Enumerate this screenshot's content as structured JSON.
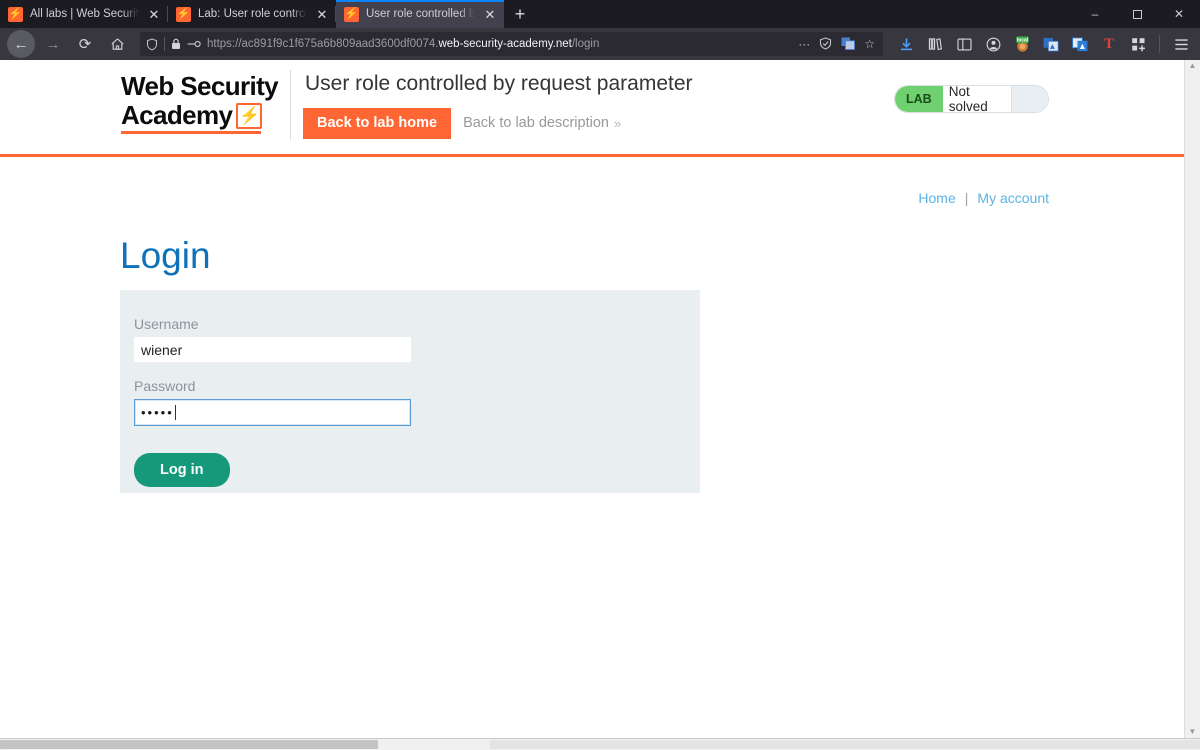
{
  "browser": {
    "tabs": [
      {
        "title": "All labs | Web Security Academy",
        "active": false,
        "favicon": "lightning-bolt-icon"
      },
      {
        "title": "Lab: User role controlled by req",
        "active": false,
        "favicon": "lightning-bolt-icon"
      },
      {
        "title": "User role controlled by request",
        "active": true,
        "favicon": "lightning-bolt-icon"
      }
    ],
    "new_tab_label": "+",
    "window_controls": {
      "minimize": "–",
      "maximize": "❐",
      "close": "✕"
    },
    "nav": {
      "back": "←",
      "forward": "→",
      "reload": "⟳",
      "home": "⌂"
    },
    "url": {
      "shield_icon": "⛉",
      "lock_icon": "🔒",
      "permission_icon": "⚷",
      "prefix": "https://ac891f9c1f675a6b809aad3600df0074.",
      "host": "web-security-academy.net",
      "path": "/login",
      "full": "https://ac891f9c1f675a6b809aad3600df0074.web-security-academy.net/login",
      "more_actions": "···",
      "reader_icon": "⛉",
      "translate_icon": "⧉",
      "bookmark_icon": "☆"
    },
    "toolbar_icons": [
      {
        "name": "downloads-icon",
        "glyph": "⤓",
        "color": "#4a9eff"
      },
      {
        "name": "library-icon",
        "glyph": "‖∖",
        "color": "#d7d7db"
      },
      {
        "name": "sidebar-icon",
        "glyph": "◫",
        "color": "#d7d7db"
      },
      {
        "name": "account-icon",
        "glyph": "ⓘ",
        "color": "#d7d7db"
      },
      {
        "name": "local-extension-icon",
        "glyph": "◕",
        "color": "#d98f4a",
        "badge": "local"
      },
      {
        "name": "extension-blue-icon",
        "glyph": "▣",
        "color": "#4a7fd0"
      },
      {
        "name": "extension-autofill-icon",
        "glyph": "◉",
        "color": "#2b7fd8"
      },
      {
        "name": "text-tool-icon",
        "glyph": "T",
        "color": "#d9453a"
      },
      {
        "name": "extensions-grid-icon",
        "glyph": "⠿",
        "color": "#d7d7db"
      },
      {
        "name": "app-menu-icon",
        "glyph": "☰",
        "color": "#d7d7db"
      }
    ]
  },
  "site": {
    "logo": {
      "line1": "Web Security",
      "line2": "Academy",
      "bolt_icon": "lightning-bolt-icon"
    },
    "lab_title": "User role controlled by request parameter",
    "back_to_lab_home": "Back to lab home",
    "back_to_lab_description": "Back to lab description",
    "chevron": "»",
    "status": {
      "badge": "LAB",
      "state": "Not solved",
      "badge_color": "#6ed06e"
    },
    "accent_color": "#ff6633"
  },
  "page": {
    "topnav": {
      "home": "Home",
      "separator": "|",
      "my_account": "My account"
    },
    "heading": "Login",
    "form": {
      "username_label": "Username",
      "username_value": "wiener",
      "username_placeholder": "",
      "password_label": "Password",
      "password_value": "•••••",
      "password_placeholder": "",
      "submit_label": "Log in",
      "submit_color": "#16987a",
      "background_color": "#e9eef1"
    },
    "heading_color": "#0e72ba"
  }
}
